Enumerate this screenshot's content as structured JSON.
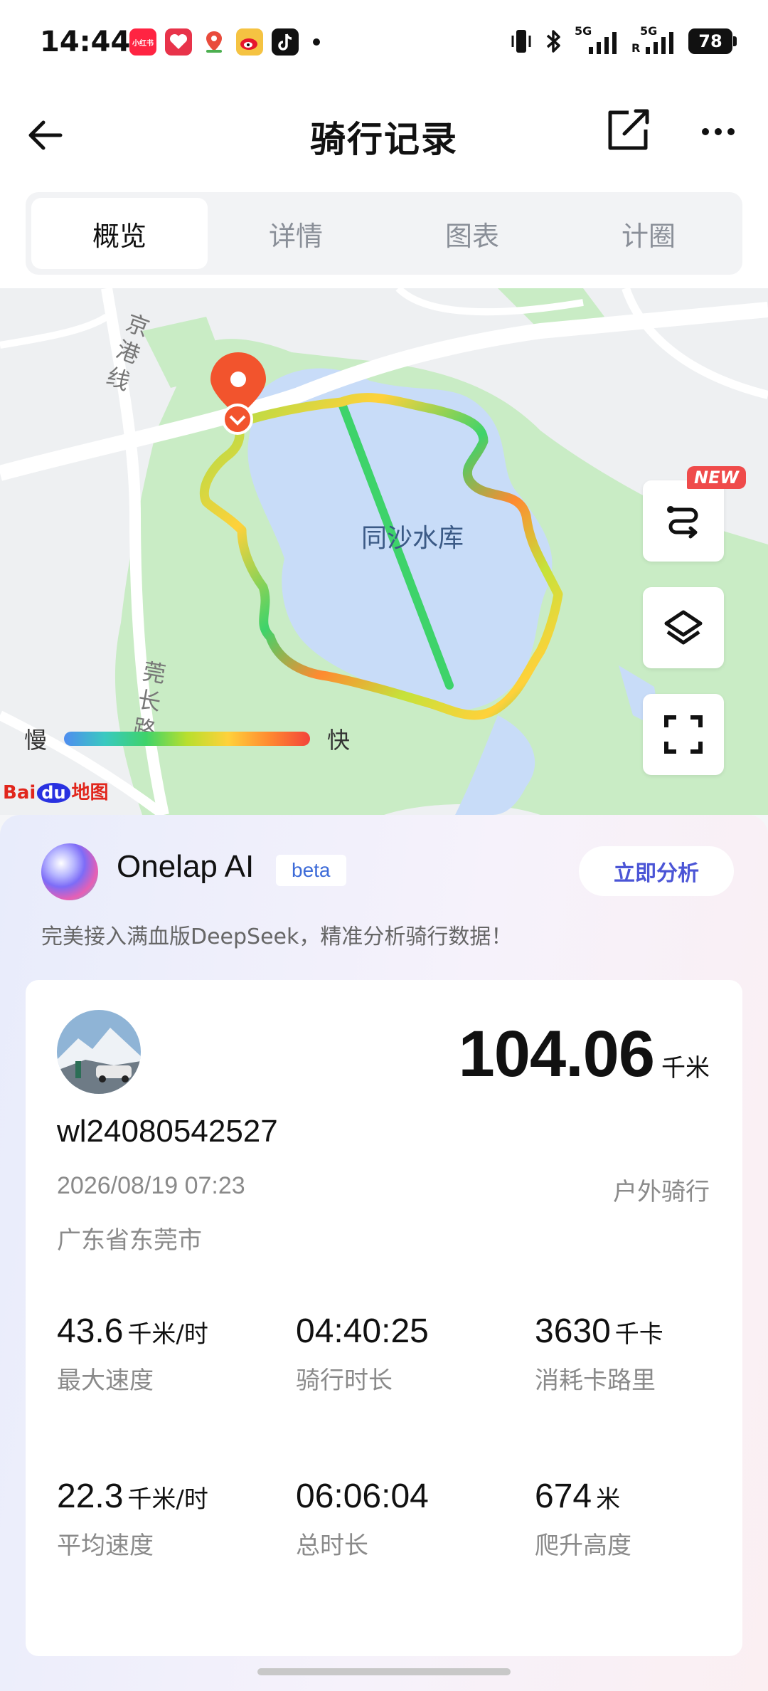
{
  "status_bar": {
    "time": "14:44",
    "app_icons": [
      "xiaohongshu-icon",
      "heart-app-icon",
      "maps-icon",
      "weibo-icon",
      "tiktok-icon"
    ],
    "app_icon_text_1": "小红书",
    "signal_1": "5G",
    "signal_2": "5G",
    "signal_2_roaming": "R",
    "battery": "78"
  },
  "header": {
    "title": "骑行记录"
  },
  "tabs": [
    {
      "label": "概览",
      "active": true
    },
    {
      "label": "详情",
      "active": false
    },
    {
      "label": "图表",
      "active": false
    },
    {
      "label": "计圈",
      "active": false
    }
  ],
  "map": {
    "lake_label": "同沙水库",
    "road_label_1": "京港线",
    "road_label_2": "莞长路",
    "legend_slow": "慢",
    "legend_fast": "快",
    "provider": "地图",
    "provider_prefix": "Bai",
    "provider_mid": "du",
    "new_badge": "NEW",
    "colors": {
      "water": "#c8dcf8",
      "park": "#c9ecc5",
      "road": "#ffffff"
    }
  },
  "ai": {
    "title": "Onelap AI",
    "badge": "beta",
    "action": "立即分析",
    "description": "完美接入满血版DeepSeek，精准分析骑行数据！"
  },
  "ride": {
    "distance": "104.06",
    "distance_unit": "千米",
    "username": "wl24080542527",
    "datetime": "2026/08/19 07:23",
    "type": "户外骑行",
    "location": "广东省东莞市",
    "stats": [
      {
        "value": "43.6",
        "unit": "千米/时",
        "label": "最大速度"
      },
      {
        "value": "04:40:25",
        "unit": "",
        "label": "骑行时长"
      },
      {
        "value": "3630",
        "unit": "千卡",
        "label": "消耗卡路里"
      },
      {
        "value": "22.3",
        "unit": "千米/时",
        "label": "平均速度"
      },
      {
        "value": "06:06:04",
        "unit": "",
        "label": "总时长"
      },
      {
        "value": "674",
        "unit": "米",
        "label": "爬升高度"
      }
    ]
  }
}
